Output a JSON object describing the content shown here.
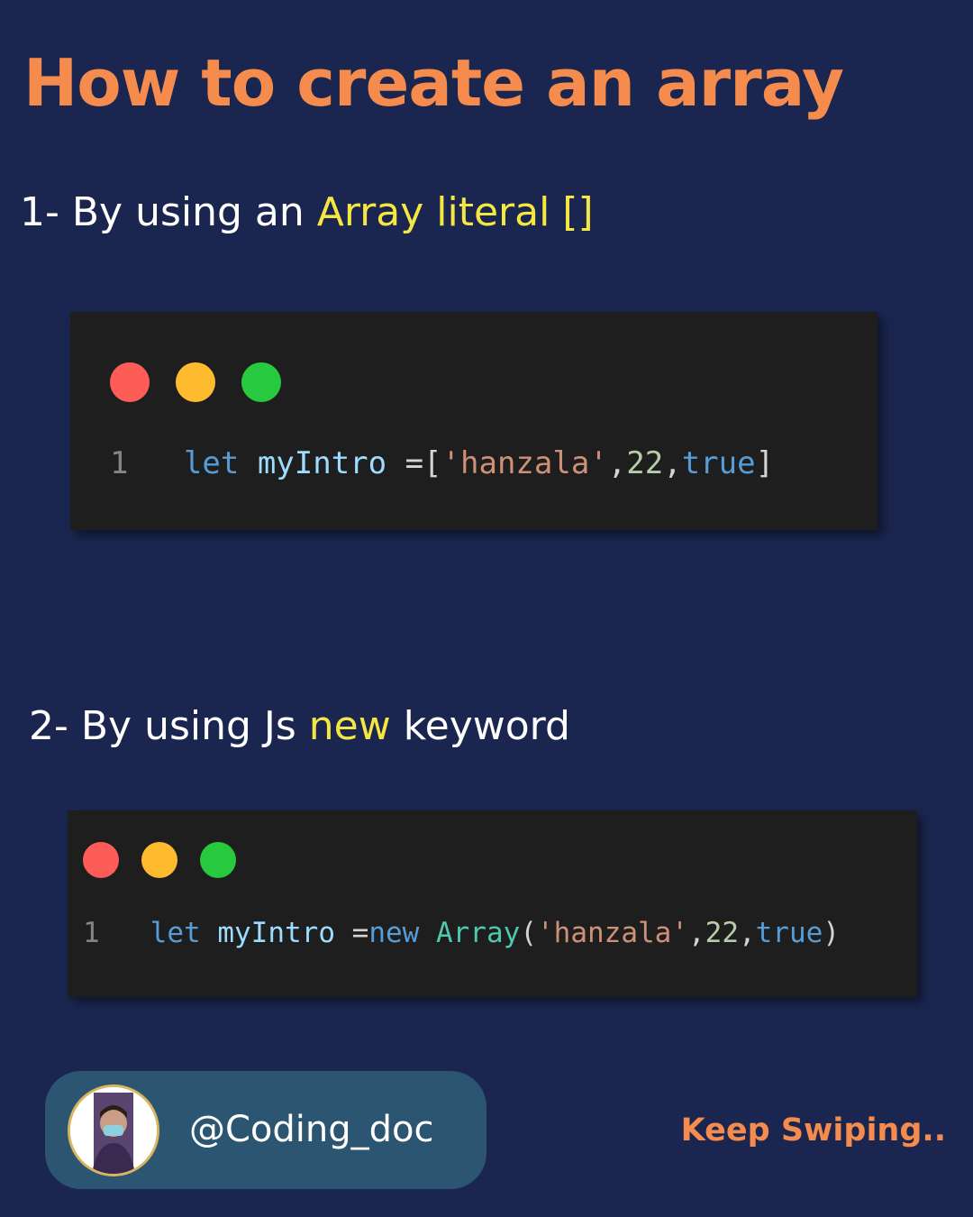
{
  "title": "How to create an array",
  "section_1": {
    "prefix": "1- By using an ",
    "highlight": "Array literal []"
  },
  "code_1": {
    "line_number": "1",
    "tokens": [
      {
        "text": "let",
        "kind": "keyword"
      },
      {
        "text": " ",
        "kind": "space"
      },
      {
        "text": "myIntro",
        "kind": "variable"
      },
      {
        "text": " =[",
        "kind": "punctuation"
      },
      {
        "text": "'hanzala'",
        "kind": "string"
      },
      {
        "text": ",",
        "kind": "punctuation"
      },
      {
        "text": "22",
        "kind": "number"
      },
      {
        "text": ",",
        "kind": "punctuation"
      },
      {
        "text": "true",
        "kind": "keyword"
      },
      {
        "text": "]",
        "kind": "punctuation"
      }
    ]
  },
  "section_2": {
    "prefix": "2- By using Js ",
    "highlight": "new",
    "suffix": " keyword"
  },
  "code_2": {
    "line_number": "1",
    "tokens": [
      {
        "text": "let",
        "kind": "keyword"
      },
      {
        "text": " ",
        "kind": "space"
      },
      {
        "text": "myIntro",
        "kind": "variable"
      },
      {
        "text": " =",
        "kind": "punctuation"
      },
      {
        "text": "new",
        "kind": "keyword"
      },
      {
        "text": " ",
        "kind": "space"
      },
      {
        "text": "Array",
        "kind": "class"
      },
      {
        "text": "(",
        "kind": "punctuation"
      },
      {
        "text": "'hanzala'",
        "kind": "string"
      },
      {
        "text": ",",
        "kind": "punctuation"
      },
      {
        "text": "22",
        "kind": "number"
      },
      {
        "text": ",",
        "kind": "punctuation"
      },
      {
        "text": "true",
        "kind": "keyword"
      },
      {
        "text": ")",
        "kind": "punctuation"
      }
    ]
  },
  "window_controls": [
    "close-dot",
    "minimize-dot",
    "maximize-dot"
  ],
  "profile": {
    "handle": "@Coding_doc",
    "avatar_icon": "user-avatar"
  },
  "cta": "Keep Swiping..",
  "colors": {
    "background": "#1b2650",
    "title": "#f58c4e",
    "highlight": "#f5e742",
    "code_bg": "#1e1e1e",
    "pill": "#2c5571",
    "dot_red": "#fe5c57",
    "dot_yellow": "#febb2e",
    "dot_green": "#27c93f"
  }
}
